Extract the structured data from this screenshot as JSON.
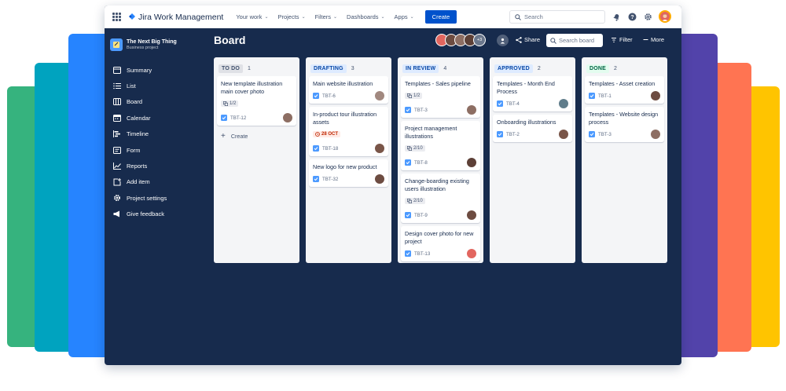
{
  "colors": {
    "band_green": "#36B37E",
    "band_teal": "#00A3BF",
    "band_blue": "#2684FF",
    "band_purple": "#5243AA",
    "band_orange": "#FF7452",
    "band_yellow": "#FFC400",
    "window_bg": "#172B4D",
    "primary": "#0052CC"
  },
  "topbar": {
    "logo_text": "Jira Work Management",
    "nav": [
      {
        "label": "Your work"
      },
      {
        "label": "Projects"
      },
      {
        "label": "Filters"
      },
      {
        "label": "Dashboards"
      },
      {
        "label": "Apps"
      }
    ],
    "create_label": "Create",
    "search_placeholder": "Search",
    "icons": [
      "notifications-icon",
      "help-icon",
      "settings-icon"
    ]
  },
  "sidebar": {
    "project_name": "The Next Big Thing",
    "project_type": "Business project",
    "items": [
      {
        "label": "Summary",
        "icon": "summary-icon"
      },
      {
        "label": "List",
        "icon": "list-icon"
      },
      {
        "label": "Board",
        "icon": "board-icon"
      },
      {
        "label": "Calendar",
        "icon": "calendar-icon"
      },
      {
        "label": "Timeline",
        "icon": "timeline-icon"
      },
      {
        "label": "Form",
        "icon": "form-icon"
      },
      {
        "label": "Reports",
        "icon": "reports-icon"
      },
      {
        "label": "Add item",
        "icon": "add-item-icon"
      },
      {
        "label": "Project settings",
        "icon": "project-settings-icon"
      },
      {
        "label": "Give feedback",
        "icon": "feedback-icon"
      }
    ]
  },
  "board": {
    "title": "Board",
    "avatars_more": "+3",
    "share_label": "Share",
    "search_placeholder": "Search board",
    "filter_label": "Filter",
    "more_label": "More",
    "columns": [
      {
        "name": "TO DO",
        "count": "1",
        "tag_bg": "#DFE1E6",
        "tag_fg": "#42526E",
        "create_label": "Create",
        "cards": [
          {
            "title": "New template illustration main cover photo",
            "subtask": "1/2",
            "key": "TBT-12",
            "avatar": "#8D6E63"
          }
        ]
      },
      {
        "name": "DRAFTING",
        "count": "3",
        "tag_bg": "#DEEBFF",
        "tag_fg": "#0747A6",
        "cards": [
          {
            "title": "Main website illustration",
            "key": "TBT-6",
            "avatar": "#A1887F"
          },
          {
            "title": "In-product tour illustration assets",
            "due": "28 OCT",
            "key": "TBT-18",
            "avatar": "#795548"
          },
          {
            "title": "New logo for new product",
            "key": "TBT-32",
            "avatar": "#6D4C41"
          }
        ]
      },
      {
        "name": "IN REVIEW",
        "count": "4",
        "tag_bg": "#DEEBFF",
        "tag_fg": "#0747A6",
        "cards": [
          {
            "title": "Templates - Sales pipeline",
            "subtask": "1/2",
            "key": "TBT-3",
            "avatar": "#8D6E63"
          },
          {
            "title": "Project management illustrations",
            "subtask": "2/10",
            "key": "TBT-8",
            "avatar": "#5D4037"
          },
          {
            "title": "Change-boarding existing users illustration",
            "subtask": "2/10",
            "key": "TBT-9",
            "avatar": "#6D4C41"
          },
          {
            "title": "Design cover photo for new project",
            "key": "TBT-13",
            "avatar": "#E2665F"
          }
        ]
      },
      {
        "name": "APPROVED",
        "count": "2",
        "tag_bg": "#DEEBFF",
        "tag_fg": "#0747A6",
        "cards": [
          {
            "title": "Templates - Month End Process",
            "key": "TBT-4",
            "avatar": "#607D8B"
          },
          {
            "title": "Onboarding illustrations",
            "key": "TBT-2",
            "avatar": "#795548"
          }
        ]
      },
      {
        "name": "DONE",
        "count": "2",
        "tag_bg": "#E3FCEF",
        "tag_fg": "#006644",
        "cards": [
          {
            "title": "Templates - Asset creation",
            "key": "TBT-1",
            "avatar": "#6D4C41"
          },
          {
            "title": "Templates - Website design process",
            "key": "TBT-3",
            "avatar": "#8D6E63"
          }
        ]
      }
    ]
  }
}
